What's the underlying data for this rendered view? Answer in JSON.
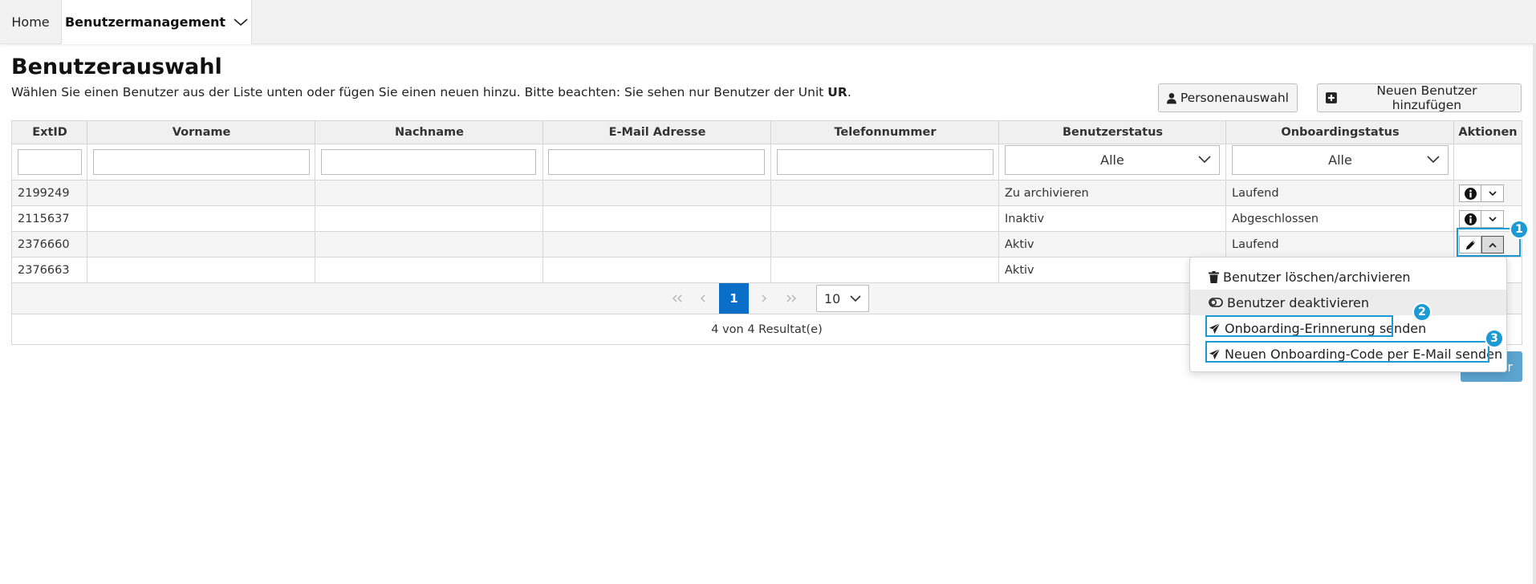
{
  "nav": {
    "home": "Home",
    "active": "Benutzermanagement"
  },
  "page": {
    "title": "Benutzerauswahl",
    "description": "Wählen Sie einen Benutzer aus der Liste unten oder fügen Sie einen neuen hinzu. Bitte beachten: Sie sehen nur Benutzer der Unit ",
    "unit": "UR",
    "description_end": "."
  },
  "buttons": {
    "persons": "Personenauswahl",
    "add_user": "Neuen Benutzer hinzufügen",
    "hidden_button_text": "r"
  },
  "table": {
    "columns": [
      "ExtID",
      "Vorname",
      "Nachname",
      "E-Mail Adresse",
      "Telefonnummer",
      "Benutzerstatus",
      "Onboardingstatus",
      "Aktionen"
    ],
    "filters": {
      "user_status": "Alle",
      "onboarding_status": "Alle"
    },
    "rows": [
      {
        "ext_id": "2199249",
        "user_status": "Zu archivieren",
        "onboarding_status": "Laufend"
      },
      {
        "ext_id": "2115637",
        "user_status": "Inaktiv",
        "onboarding_status": "Abgeschlossen"
      },
      {
        "ext_id": "2376660",
        "user_status": "Aktiv",
        "onboarding_status": "Laufend"
      },
      {
        "ext_id": "2376663",
        "user_status": "Aktiv",
        "onboarding_status": ""
      }
    ]
  },
  "pagination": {
    "current_page": "1",
    "page_size": "10",
    "result_text": "4 von 4 Resultat(e)"
  },
  "dropdown_menu": {
    "items": [
      {
        "label": "Benutzer löschen/archivieren",
        "icon": "trash-icon"
      },
      {
        "label": "Benutzer deaktivieren",
        "icon": "toggle-off-icon"
      },
      {
        "label": "Onboarding-Erinnerung senden",
        "icon": "send-icon"
      },
      {
        "label": "Neuen Onboarding-Code per E-Mail senden",
        "icon": "send-icon"
      }
    ]
  },
  "annotations": {
    "badge1": "1",
    "badge2": "2",
    "badge3": "3"
  },
  "colors": {
    "accent": "#1b9ad6",
    "page_active": "#0a6fc9",
    "header_bg": "#f0f0f0"
  }
}
